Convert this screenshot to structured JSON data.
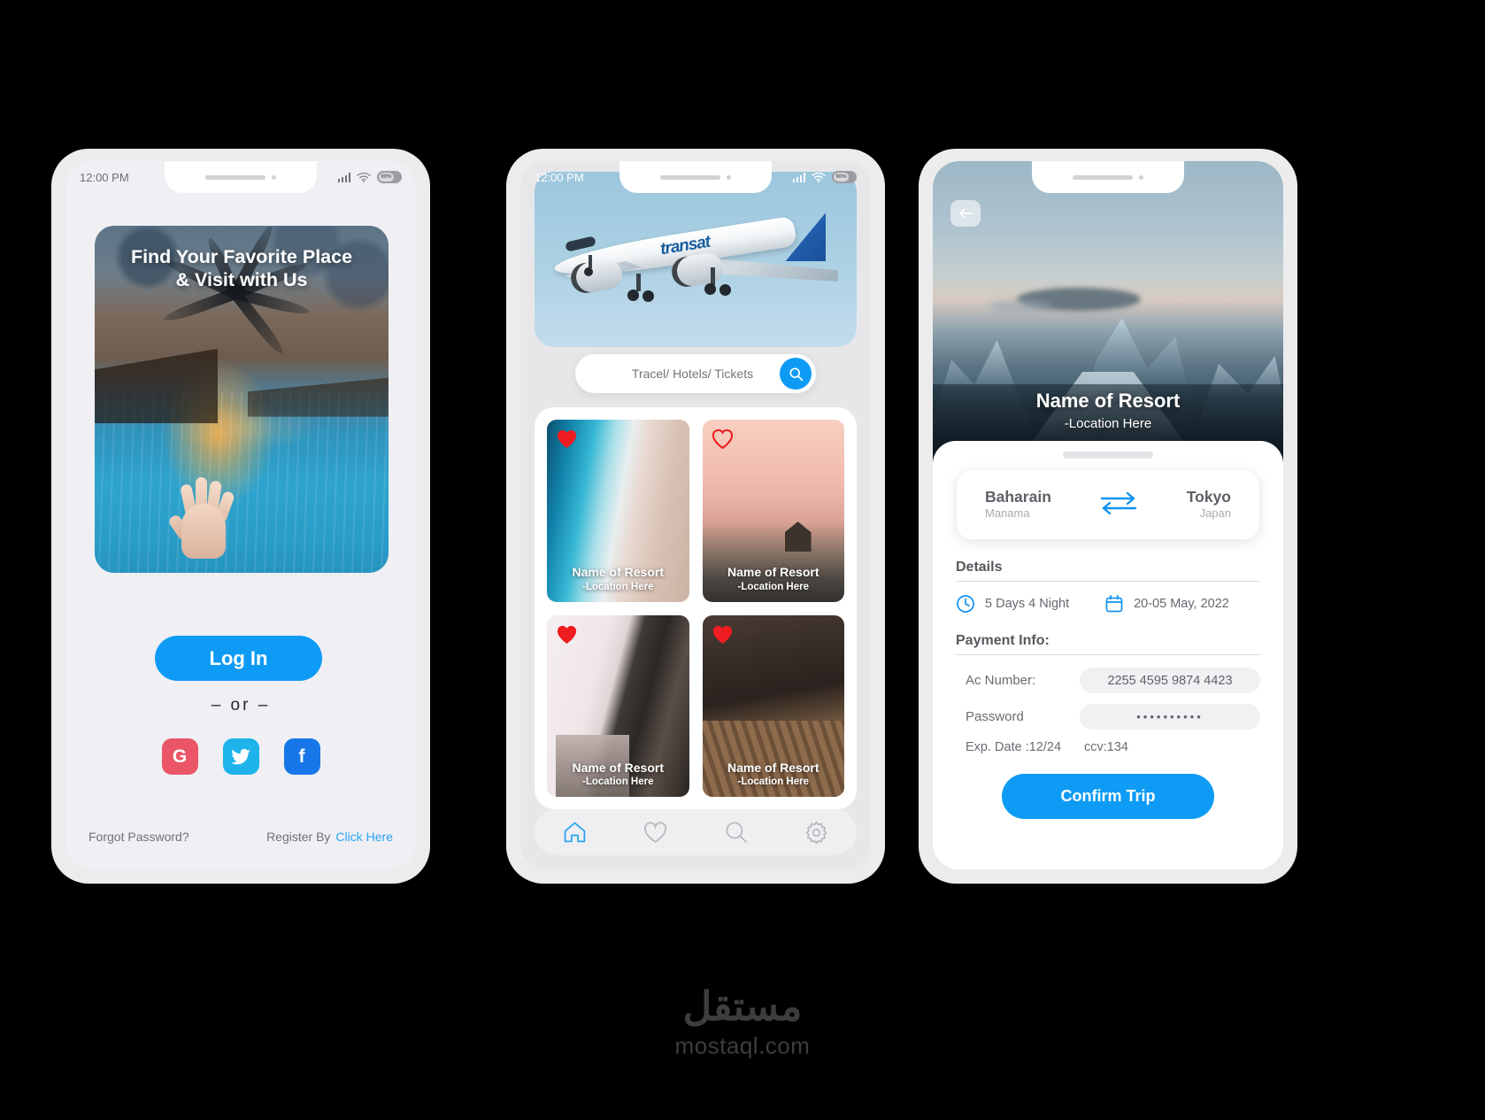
{
  "screens": {
    "login": {
      "status": {
        "time": "12:00 PM",
        "battery": "90%"
      },
      "hero_title_line1": "Find Your Favorite Place",
      "hero_title_line2": "& Visit with Us",
      "login_button": "Log In",
      "or_divider": "–  or  –",
      "socials": [
        {
          "name": "google",
          "glyph": "G",
          "color": "#ea5667"
        },
        {
          "name": "twitter",
          "glyph": "✓",
          "color": "#1fb3ec"
        },
        {
          "name": "facebook",
          "glyph": "f",
          "color": "#1877e8"
        }
      ],
      "forgot_password": "Forgot Password?",
      "register_by": "Register By",
      "register_link": "Click Here"
    },
    "home": {
      "status": {
        "time": "12:00 PM",
        "battery": "90%"
      },
      "plane_livery": "transat",
      "search_placeholder": "Tracel/ Hotels/ Tickets",
      "search_value": "",
      "search_icon": "search-icon",
      "cards": [
        {
          "name": "Name of Resort",
          "location": "-Location Here",
          "liked": true,
          "image": "beach"
        },
        {
          "name": "Name of Resort",
          "location": "-Location Here",
          "liked": false,
          "image": "sunset"
        },
        {
          "name": "Name of Resort",
          "location": "-Location Here",
          "liked": true,
          "image": "window"
        },
        {
          "name": "Name of Resort",
          "location": "-Location Here",
          "liked": true,
          "image": "dock"
        }
      ],
      "tabs": [
        {
          "icon": "home-icon",
          "label": "Home",
          "active": true
        },
        {
          "icon": "heart-icon",
          "label": "Favorites",
          "active": false
        },
        {
          "icon": "search-icon",
          "label": "Search",
          "active": false
        },
        {
          "icon": "gear-icon",
          "label": "Settings",
          "active": false
        }
      ]
    },
    "details": {
      "back_icon": "arrow-left-icon",
      "resort_name": "Name of Resort",
      "resort_location": "-Location Here",
      "route": {
        "from_city": "Baharain",
        "from_sub": "Manama",
        "to_city": "Tokyo",
        "to_sub": "Japan",
        "swap_icon": "swap-arrows-icon"
      },
      "details_title": "Details",
      "duration": "5 Days 4 Night",
      "duration_icon": "clock-icon",
      "dates": "20-05 May, 2022",
      "dates_icon": "calendar-icon",
      "payment_title": "Payment Info:",
      "ac_number_label": "Ac Number:",
      "ac_number_value": "2255 4595 9874 4423",
      "password_label": "Password",
      "password_value": "••••••••••",
      "exp_date": "Exp. Date :12/24",
      "ccv": "ccv:134",
      "confirm_button": "Confirm Trip"
    }
  },
  "watermark": {
    "arabic": "مستقل",
    "english": "mostaql.com"
  },
  "colors": {
    "accent": "#0e9bf5",
    "link": "#2aa4f4",
    "heart": "#ef1c21",
    "body_bg": "#000000",
    "phone_frame": "#ececed",
    "screen_bg": "#efeff4"
  }
}
